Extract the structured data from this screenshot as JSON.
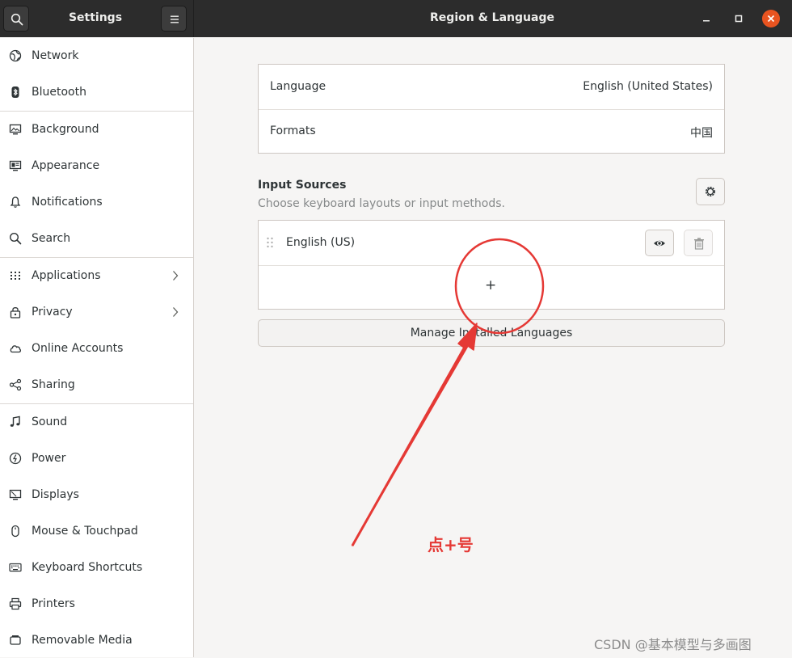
{
  "header": {
    "app_title": "Settings",
    "page_title": "Region & Language"
  },
  "sidebar": {
    "items": [
      {
        "label": "Network",
        "icon": "network-icon"
      },
      {
        "label": "Bluetooth",
        "icon": "bluetooth-icon"
      },
      {
        "label": "Background",
        "icon": "background-icon"
      },
      {
        "label": "Appearance",
        "icon": "appearance-icon"
      },
      {
        "label": "Notifications",
        "icon": "bell-icon"
      },
      {
        "label": "Search",
        "icon": "search-icon"
      },
      {
        "label": "Applications",
        "icon": "grid-icon",
        "has_submenu": true
      },
      {
        "label": "Privacy",
        "icon": "lock-icon",
        "has_submenu": true
      },
      {
        "label": "Online Accounts",
        "icon": "cloud-icon"
      },
      {
        "label": "Sharing",
        "icon": "share-icon"
      },
      {
        "label": "Sound",
        "icon": "music-note-icon"
      },
      {
        "label": "Power",
        "icon": "power-icon"
      },
      {
        "label": "Displays",
        "icon": "display-icon"
      },
      {
        "label": "Mouse & Touchpad",
        "icon": "mouse-icon"
      },
      {
        "label": "Keyboard Shortcuts",
        "icon": "keyboard-icon"
      },
      {
        "label": "Printers",
        "icon": "printer-icon"
      },
      {
        "label": "Removable Media",
        "icon": "removable-media-icon"
      }
    ]
  },
  "region": {
    "language_label": "Language",
    "language_value": "English (United States)",
    "formats_label": "Formats",
    "formats_value": "中国"
  },
  "input_sources": {
    "title": "Input Sources",
    "subtitle": "Choose keyboard layouts or input methods.",
    "items": [
      {
        "label": "English (US)"
      }
    ],
    "add_symbol": "+",
    "manage_label": "Manage Installed Languages"
  },
  "annotation": {
    "text": "点+号",
    "color": "#e53935"
  },
  "watermark": "CSDN @基本模型与多画图",
  "colors": {
    "accent": "#e95420",
    "headerbar": "#2c2c2c"
  }
}
